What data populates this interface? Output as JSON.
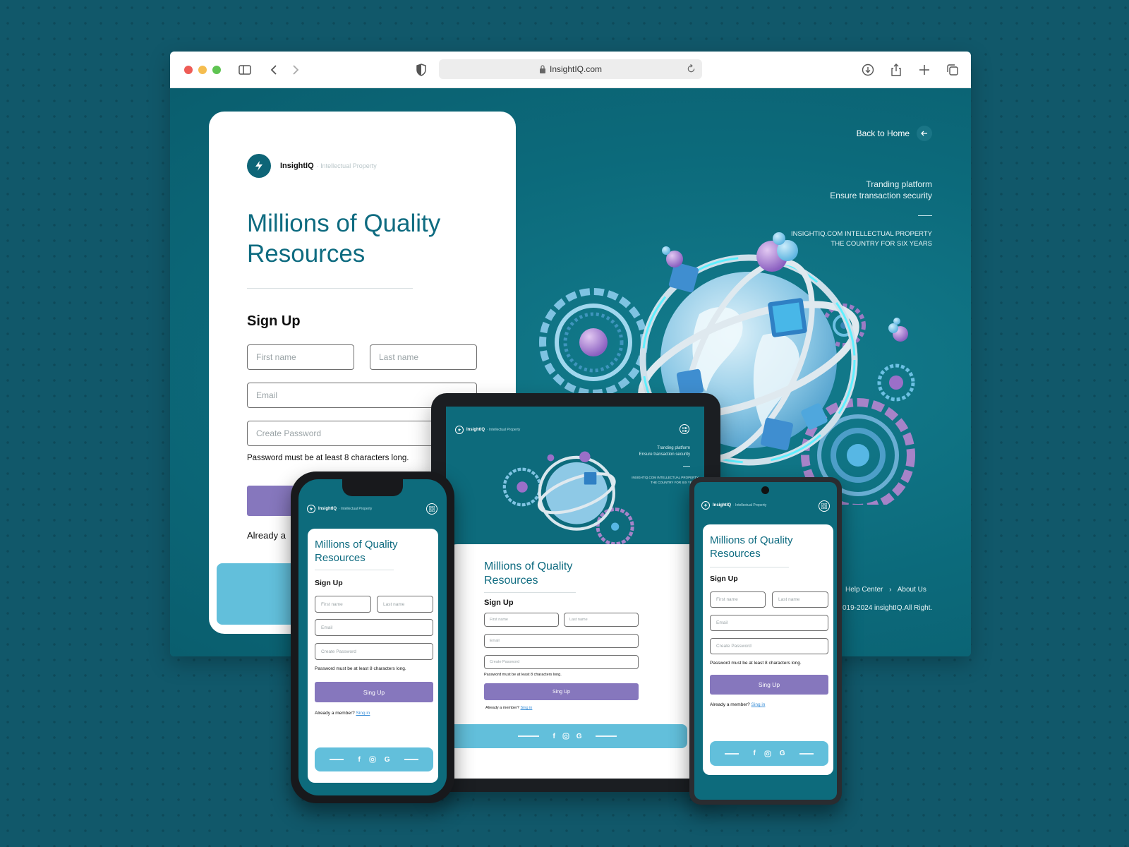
{
  "browser": {
    "url": "InsightIQ.com"
  },
  "brand": {
    "name": "InsightIQ",
    "tagline": "· Intellectual Property"
  },
  "hero": {
    "title_line1": "Millions of Quality",
    "title_line2": "Resources"
  },
  "signup": {
    "title": "Sign Up",
    "first_name_placeholder": "First name",
    "last_name_placeholder": "Last name",
    "email_placeholder": "Email",
    "password_placeholder": "Create Password",
    "password_hint": "Password must be at least 8 characters long.",
    "submit_label": "Sing Up",
    "member_text": "Already a member?",
    "signin_link": "Sing in",
    "member_text_truncated": "Already a"
  },
  "right_panel": {
    "back_home": "Back to Home",
    "tagline_1": "Tranding platform",
    "tagline_2": "Ensure transaction security",
    "info_1": "INSIGHTIQ.COM INTELLECTUAL PROPERTY",
    "info_2": "THE COUNTRY FOR SIX YEARS",
    "info_1_short": "INSIGHTIQ.COM INTELLECTUAL PROPERTY",
    "info_2_short": "THE COUNTRY FOR SIX YEARS"
  },
  "footer": {
    "help_center": "Help Center",
    "separator": "›",
    "about_us": "About Us",
    "copyright": "019-2024 insightIQ.All Right."
  },
  "social": {
    "icons": [
      "facebook-icon",
      "instagram-icon",
      "google-icon"
    ],
    "facebook_glyph": "f",
    "google_glyph": "G"
  },
  "colors": {
    "teal_bg": "#0d6b7c",
    "title_teal": "#0e6b80",
    "button_purple": "#8677bd",
    "social_blue": "#62bfdb",
    "link_blue": "#3a8fd8"
  }
}
